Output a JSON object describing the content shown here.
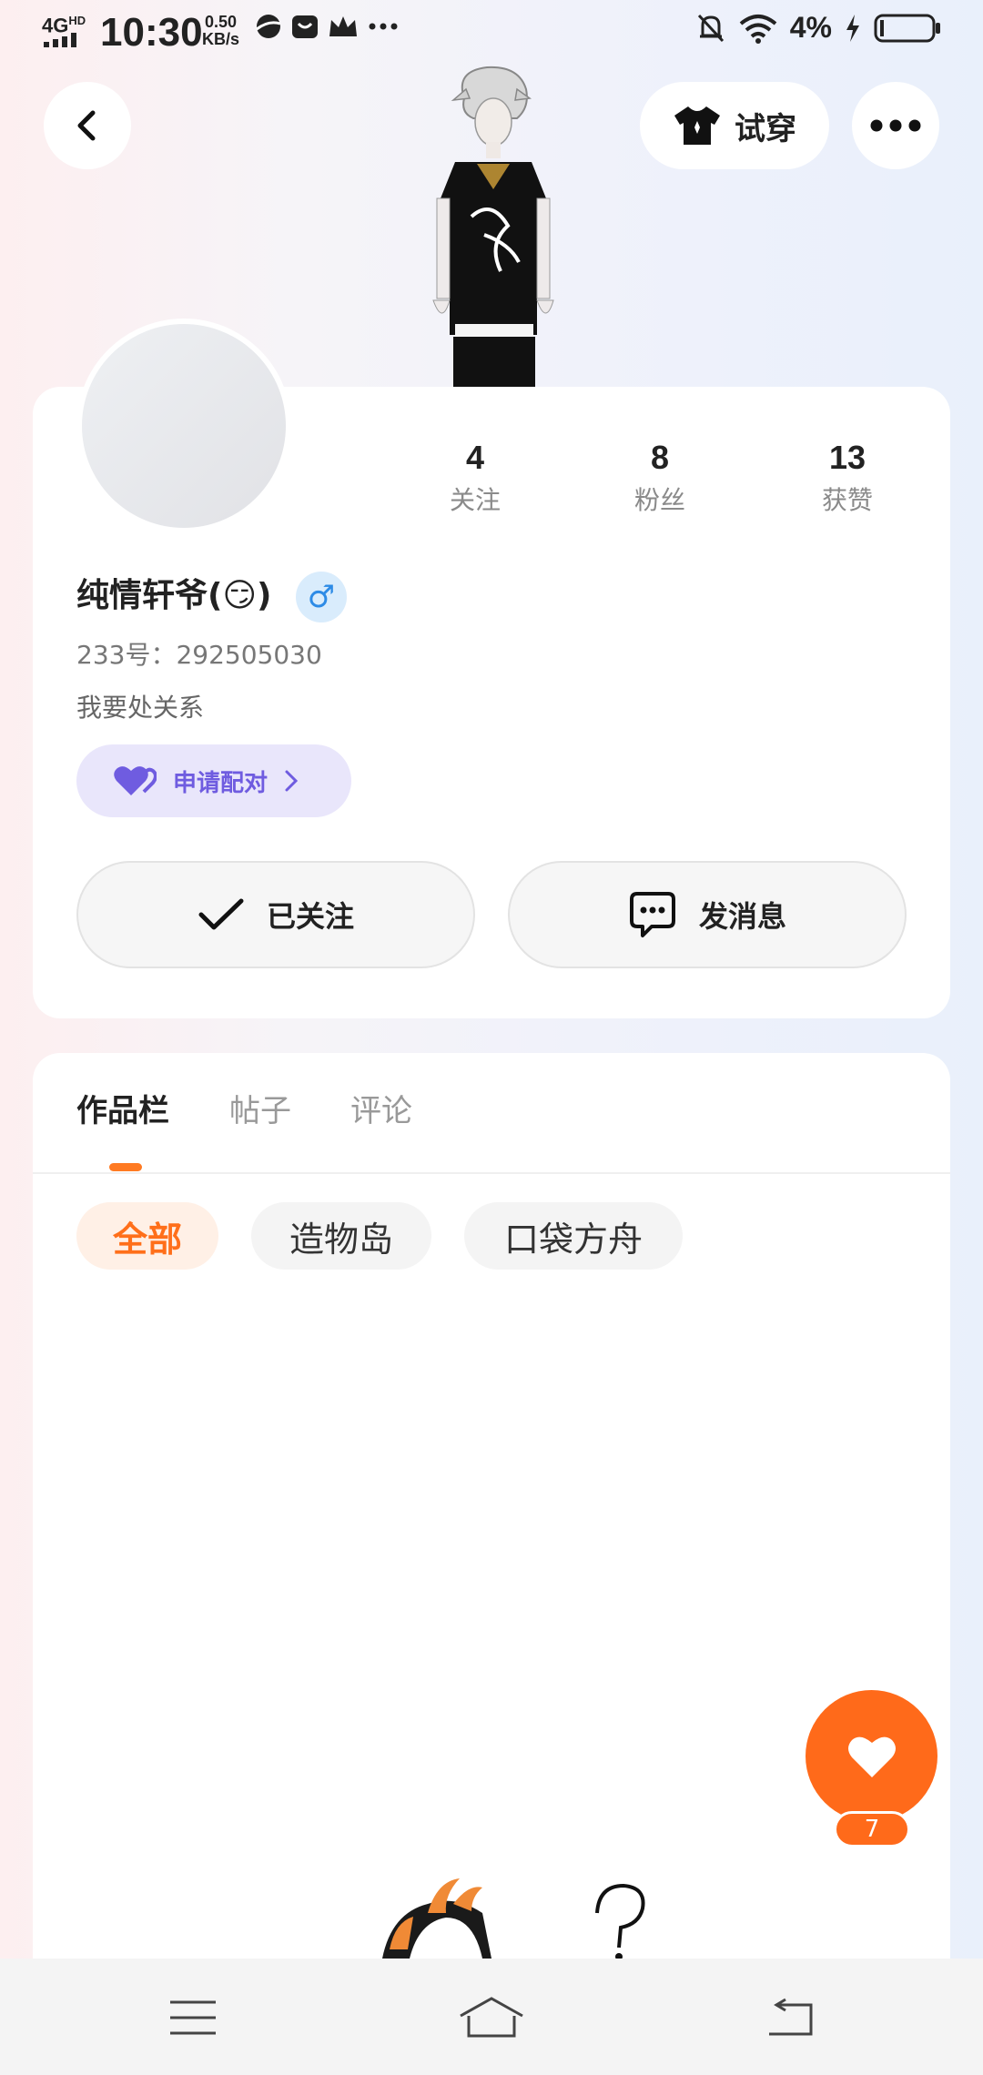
{
  "status_bar": {
    "network": "4G",
    "network_sup": "HD",
    "time": "10:30",
    "speed_value": "0.50",
    "speed_unit": "KB/s",
    "battery_percent": "4%"
  },
  "header": {
    "try_on_label": "试穿"
  },
  "profile": {
    "stats": [
      {
        "value": "4",
        "label": "关注"
      },
      {
        "value": "8",
        "label": "粉丝"
      },
      {
        "value": "13",
        "label": "获赞"
      }
    ],
    "username": "纯情轩爷(😏)",
    "gender_symbol": "♂",
    "user_id": "233号：292505030",
    "bio": "我要处关系",
    "match_label": "申请配对",
    "followed_label": "已关注",
    "message_label": "发消息"
  },
  "works": {
    "tabs": [
      "作品栏",
      "帖子",
      "评论"
    ],
    "filters": [
      "全部",
      "造物岛",
      "口袋方舟"
    ]
  },
  "like_fab": {
    "count": "7"
  },
  "colors": {
    "accent": "#ff6a1a",
    "match_purple": "#6f5ce0",
    "gender_blue": "#2d8be6"
  },
  "icons": [
    "back-arrow-icon",
    "tshirt-icon",
    "more-dots-icon",
    "heart-icon",
    "chevron-right-icon",
    "check-icon",
    "chat-bubble-icon",
    "menu-icon",
    "home-icon",
    "return-icon"
  ]
}
